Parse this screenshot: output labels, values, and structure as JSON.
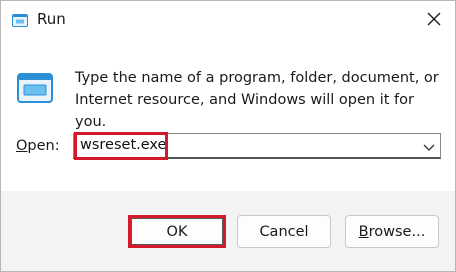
{
  "window": {
    "title": "Run",
    "close_icon": "close-icon"
  },
  "dialog": {
    "icon": "run-app-icon",
    "description_line1": "Type the name of a program, folder, document, or",
    "description_line2": "Internet resource, and Windows will open it for you.",
    "open_label_prefix": "O",
    "open_label_rest": "pen:",
    "open_value": "wsreset.exe",
    "dropdown_icon": "chevron-down-icon"
  },
  "buttons": {
    "ok": "OK",
    "cancel": "Cancel",
    "browse_prefix": "B",
    "browse_rest": "rowse..."
  },
  "colors": {
    "highlight": "#d21a2a",
    "icon_blue": "#2b8fd6"
  }
}
